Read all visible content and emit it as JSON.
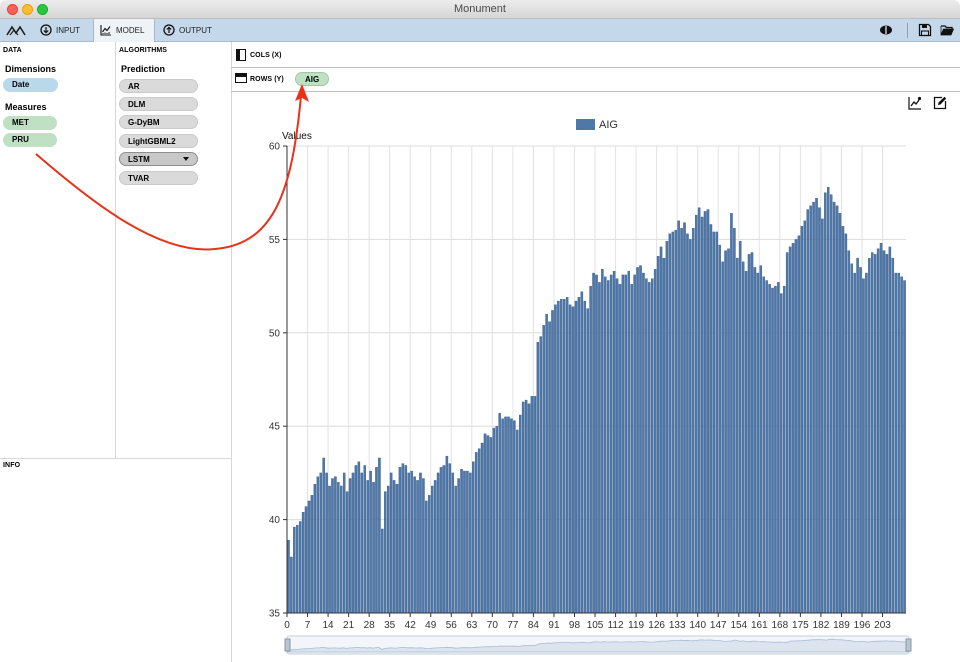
{
  "window": {
    "title": "Monument"
  },
  "tabs": [
    {
      "label": "INPUT",
      "icon": "arrow-down-circle-icon"
    },
    {
      "label": "MODEL",
      "icon": "chart-model-icon"
    },
    {
      "label": "OUTPUT",
      "icon": "arrow-up-circle-icon"
    }
  ],
  "data_panel": {
    "header": "DATA",
    "dimensions_title": "Dimensions",
    "dimensions": [
      "Date"
    ],
    "measures_title": "Measures",
    "measures": [
      "MET",
      "PRU"
    ]
  },
  "algorithms_panel": {
    "header": "ALGORITHMS",
    "section": "Prediction",
    "items": [
      "AR",
      "DLM",
      "G-DyBM",
      "LightGBML2",
      "LSTM",
      "TVAR"
    ],
    "selected": "LSTM"
  },
  "info_panel": {
    "header": "INFO"
  },
  "shelves": {
    "cols_label": "COLS (X)",
    "rows_label": "ROWS (Y)",
    "rows_pills": [
      "AIG"
    ]
  },
  "colors": {
    "bar": "#4f77a8",
    "accent_arrow": "#e8321a",
    "toolbar": "#c4d8ea"
  },
  "chart_data": {
    "type": "bar",
    "ylabel": "Values",
    "legend": "AIG",
    "legend_position": "top-center",
    "ylim": [
      35,
      60
    ],
    "yticks": [
      35,
      40,
      45,
      50,
      55,
      60
    ],
    "xticks": [
      0,
      7,
      14,
      21,
      28,
      35,
      42,
      49,
      56,
      63,
      70,
      77,
      84,
      91,
      98,
      105,
      112,
      119,
      126,
      133,
      140,
      147,
      154,
      161,
      168,
      175,
      182,
      189,
      196,
      203
    ],
    "grid": true,
    "series": [
      {
        "name": "AIG",
        "values": [
          38.9,
          38.0,
          39.6,
          39.7,
          39.9,
          40.4,
          40.7,
          41.0,
          41.3,
          41.9,
          42.3,
          42.5,
          43.3,
          42.5,
          41.8,
          42.2,
          42.3,
          42.0,
          41.8,
          42.5,
          41.5,
          42.2,
          42.5,
          42.9,
          43.1,
          42.5,
          42.9,
          42.1,
          42.6,
          42.0,
          42.8,
          43.3,
          39.5,
          41.5,
          41.8,
          42.5,
          42.1,
          41.9,
          42.8,
          43.0,
          42.9,
          42.5,
          42.6,
          42.3,
          42.1,
          42.5,
          42.2,
          41.0,
          41.3,
          41.8,
          42.1,
          42.5,
          42.8,
          42.9,
          43.4,
          43.0,
          42.5,
          41.8,
          42.2,
          42.7,
          42.6,
          42.6,
          42.5,
          43.1,
          43.6,
          43.8,
          44.1,
          44.6,
          44.5,
          44.4,
          44.9,
          45.0,
          45.7,
          45.4,
          45.5,
          45.5,
          45.4,
          45.3,
          44.8,
          45.6,
          46.3,
          46.4,
          46.2,
          46.6,
          46.6,
          49.5,
          49.8,
          50.4,
          51.0,
          50.6,
          51.2,
          51.5,
          51.7,
          51.8,
          51.8,
          51.9,
          51.5,
          51.4,
          51.7,
          51.9,
          52.2,
          51.7,
          51.3,
          52.5,
          53.2,
          53.1,
          52.7,
          53.4,
          53.0,
          52.8,
          53.1,
          53.3,
          52.9,
          52.6,
          53.1,
          53.1,
          53.3,
          52.6,
          53.1,
          53.5,
          53.6,
          53.2,
          52.9,
          52.7,
          52.9,
          53.4,
          54.1,
          54.6,
          54.0,
          54.9,
          55.3,
          55.4,
          55.5,
          56.0,
          55.6,
          55.9,
          55.3,
          55.0,
          55.6,
          56.3,
          56.7,
          56.2,
          56.5,
          56.6,
          55.8,
          55.4,
          55.4,
          54.7,
          53.8,
          54.4,
          54.5,
          56.4,
          55.6,
          54.0,
          54.9,
          53.8,
          53.3,
          54.2,
          54.3,
          53.5,
          53.2,
          53.6,
          53.0,
          52.8,
          52.6,
          52.4,
          52.5,
          52.7,
          52.1,
          52.5,
          54.3,
          54.6,
          54.8,
          55.0,
          55.2,
          55.7,
          56.0,
          56.6,
          56.8,
          57.0,
          57.2,
          56.7,
          56.1,
          57.5,
          57.8,
          57.4,
          57.0,
          56.8,
          56.4,
          55.7,
          55.3,
          54.4,
          53.7,
          53.2,
          54.0,
          53.5,
          52.9,
          53.2,
          54.0,
          54.3,
          54.2,
          54.5,
          54.8,
          54.4,
          54.2,
          54.6,
          54.0,
          53.2,
          53.2,
          53.0,
          52.8
        ]
      }
    ]
  }
}
